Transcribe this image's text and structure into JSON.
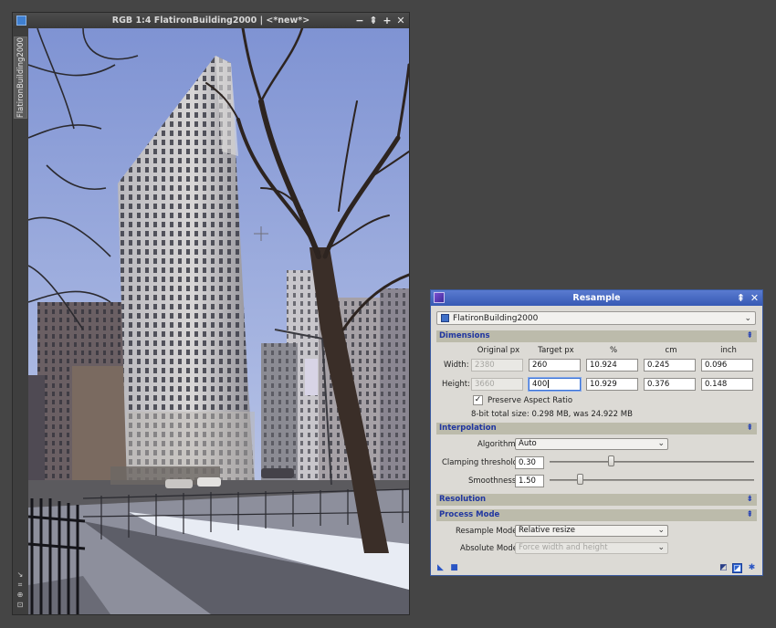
{
  "image_window": {
    "title": "RGB 1:4 FlatironBuilding2000 | <*new*>",
    "view_tab": "FlatironBuilding2000",
    "controls": {
      "minimize": "−",
      "shade": "⇞",
      "maximize": "+",
      "close": "✕"
    }
  },
  "dialog": {
    "title": "Resample",
    "view_select": "FlatironBuilding2000",
    "sections": {
      "dimensions": "Dimensions",
      "interpolation": "Interpolation",
      "resolution": "Resolution",
      "process_mode": "Process Mode"
    },
    "dimensions": {
      "columns": [
        "Original px",
        "Target px",
        "%",
        "cm",
        "inch"
      ],
      "width": {
        "label": "Width:",
        "original": "2380",
        "target": "260",
        "percent": "10.924",
        "cm": "0.245",
        "inch": "0.096"
      },
      "height": {
        "label": "Height:",
        "original": "3660",
        "target": "400",
        "percent": "10.929",
        "cm": "0.376",
        "inch": "0.148"
      },
      "preserve_aspect": "Preserve Aspect Ratio",
      "size_info": "8-bit total size: 0.298 MB, was 24.922 MB"
    },
    "interpolation": {
      "algorithm_label": "Algorithm:",
      "algorithm": "Auto",
      "clamping_label": "Clamping threshold:",
      "clamping": "0.30",
      "clamping_fraction": 0.3,
      "smoothness_label": "Smoothness:",
      "smoothness": "1.50",
      "smoothness_fraction": 0.15
    },
    "process_mode": {
      "resample_mode_label": "Resample Mode:",
      "resample_mode": "Relative resize",
      "absolute_mode_label": "Absolute Mode:",
      "absolute_mode": "Force width and height"
    }
  },
  "colors": {
    "desktop": "#454545",
    "dialog_title": "#3659b4",
    "section_bg": "#bcbbab",
    "section_text": "#2036a0"
  }
}
